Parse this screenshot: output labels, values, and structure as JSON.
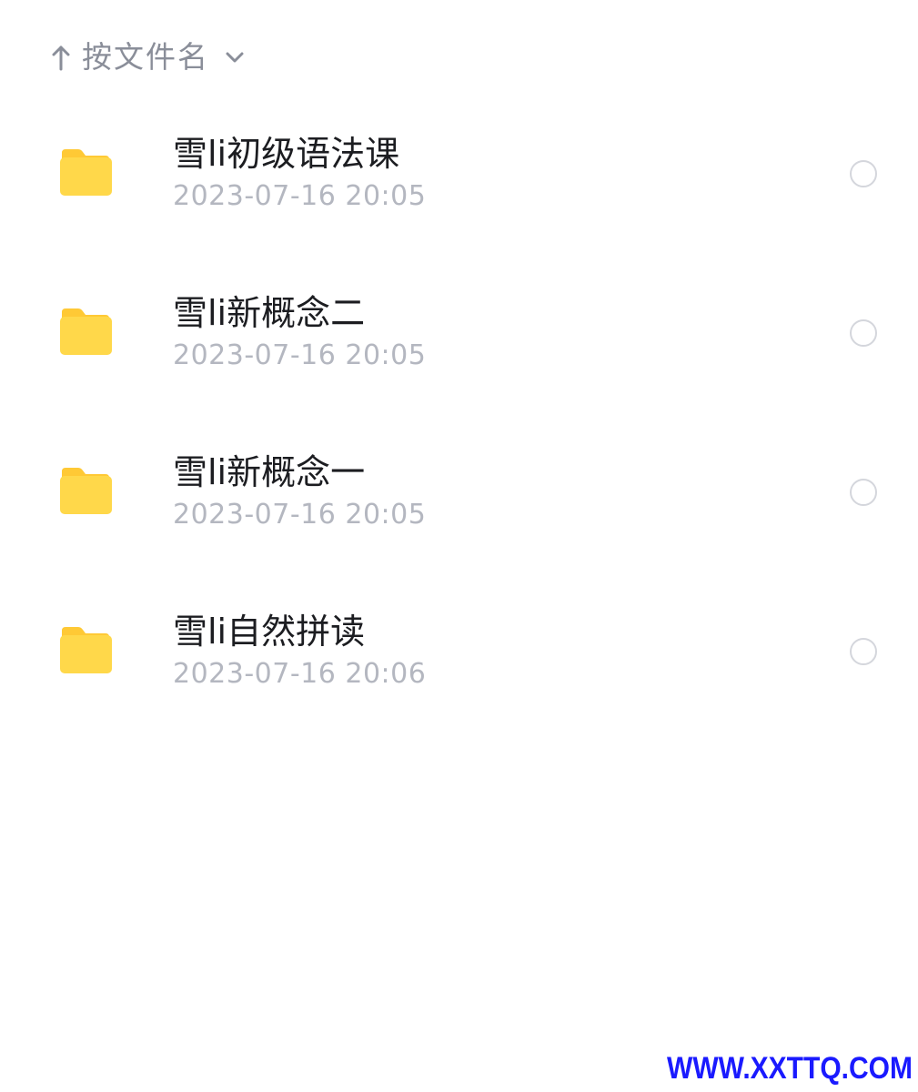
{
  "sort": {
    "label": "按文件名",
    "arrow_icon": "arrow-up-icon",
    "chevron_icon": "chevron-down-icon"
  },
  "files": [
    {
      "name": "雪li初级语法课",
      "date": "2023-07-16 20:05",
      "icon": "folder-icon"
    },
    {
      "name": "雪li新概念二",
      "date": "2023-07-16 20:05",
      "icon": "folder-icon"
    },
    {
      "name": "雪li新概念一",
      "date": "2023-07-16 20:05",
      "icon": "folder-icon"
    },
    {
      "name": "雪li自然拼读",
      "date": "2023-07-16 20:06",
      "icon": "folder-icon"
    }
  ],
  "watermark": "WWW.XXTTQ.COM",
  "colors": {
    "folder": "#FFD84A",
    "folder_tab": "#FFC935",
    "name_text": "#1C1D21",
    "date_text": "#B4B7C0",
    "sort_text": "#8A8E99",
    "radio_border": "#D4D6DC",
    "watermark": "#1A1AFF"
  }
}
